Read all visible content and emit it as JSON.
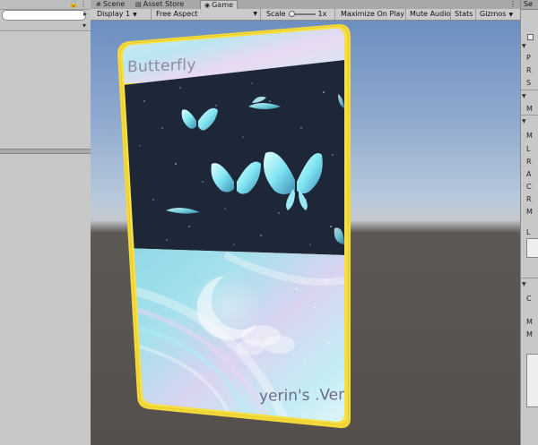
{
  "tabs": [
    {
      "label": "Scene",
      "icon": "scene-icon"
    },
    {
      "label": "Asset Store",
      "icon": "asset-store-icon"
    },
    {
      "label": "Game",
      "icon": "game-icon"
    }
  ],
  "right_tab_label": "Se",
  "toolbar": {
    "display": "Display 1",
    "aspect": "Free Aspect",
    "scale_label": "Scale",
    "scale_value": "1x",
    "maximize": "Maximize On Play",
    "mute": "Mute Audio",
    "stats": "Stats",
    "gizmos": "Gizmos"
  },
  "card": {
    "title": "Butterfly",
    "subtitle": "yerin's .Ver",
    "frame_color": "#f6e044"
  },
  "inspector": {
    "rows": [
      "P",
      "R",
      "S",
      "M",
      "M",
      "L",
      "R",
      "A",
      "C",
      "R",
      "M",
      "L",
      "C",
      "M",
      "M"
    ]
  },
  "colors": {
    "editor_bg": "#c2c2c2",
    "tab_active": "#cbcbcb"
  }
}
